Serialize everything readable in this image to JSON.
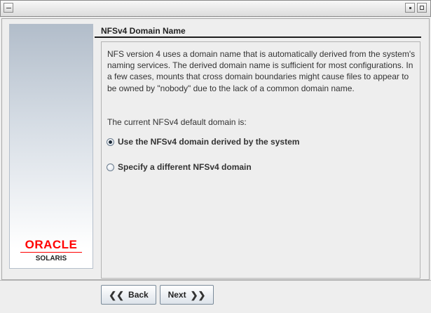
{
  "page": {
    "title": "NFSv4 Domain Name",
    "description": "NFS version 4 uses a domain name that is automatically derived from the system's naming services. The derived domain name is sufficient for most configurations. In a few cases, mounts that cross domain boundaries might cause files to appear to be owned by \"nobody\" due to the lack of a common domain name.",
    "current_domain_label": "The current NFSv4 default domain is:"
  },
  "options": [
    {
      "label": "Use the NFSv4 domain derived by the system",
      "selected": true
    },
    {
      "label": "Specify a different NFSv4 domain",
      "selected": false
    }
  ],
  "logo": {
    "brand": "ORACLE",
    "product": "SOLARIS",
    "brand_color": "#ff0000"
  },
  "buttons": {
    "back": "Back",
    "next": "Next"
  },
  "icons": {
    "back": "double-chevron-left-icon",
    "next": "double-chevron-right-icon",
    "window_menu": "window-menu-icon",
    "minimize": "minimize-icon",
    "maximize": "maximize-icon"
  }
}
